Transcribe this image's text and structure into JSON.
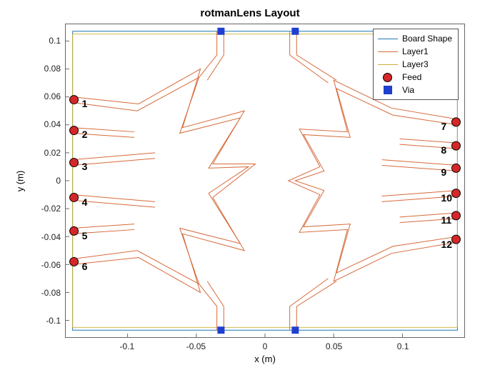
{
  "chart_data": {
    "type": "scatter",
    "title": "rotmanLens Layout",
    "xlabel": "x (m)",
    "ylabel": "y (m)",
    "xlim": [
      -0.145,
      0.145
    ],
    "ylim": [
      -0.112,
      0.112
    ],
    "x_ticks": [
      -0.1,
      -0.05,
      0,
      0.05,
      0.1
    ],
    "y_ticks": [
      -0.1,
      -0.08,
      -0.06,
      -0.04,
      -0.02,
      0,
      0.02,
      0.04,
      0.06,
      0.08,
      0.1
    ],
    "legend": {
      "entries": [
        "Board Shape",
        "Layer1",
        "Layer3",
        "Feed",
        "Via"
      ],
      "colors": {
        "Board Shape": "#1f77b4",
        "Layer1": "#d66a3a",
        "Layer3": "#c9b037",
        "Feed": "#d62728",
        "Via": "#1f3fd1"
      }
    },
    "series": [
      {
        "name": "Feed",
        "type": "marker",
        "shape": "circle",
        "points": [
          {
            "x": -0.139,
            "y": 0.058,
            "label": "1"
          },
          {
            "x": -0.139,
            "y": 0.036,
            "label": "2"
          },
          {
            "x": -0.139,
            "y": 0.013,
            "label": "3"
          },
          {
            "x": -0.139,
            "y": -0.012,
            "label": "4"
          },
          {
            "x": -0.139,
            "y": -0.036,
            "label": "5"
          },
          {
            "x": -0.139,
            "y": -0.058,
            "label": "6"
          },
          {
            "x": 0.139,
            "y": 0.042,
            "label": "7"
          },
          {
            "x": 0.139,
            "y": 0.025,
            "label": "8"
          },
          {
            "x": 0.139,
            "y": 0.009,
            "label": "9"
          },
          {
            "x": 0.139,
            "y": -0.009,
            "label": "10"
          },
          {
            "x": 0.139,
            "y": -0.025,
            "label": "11"
          },
          {
            "x": 0.139,
            "y": -0.042,
            "label": "12"
          }
        ]
      },
      {
        "name": "Via",
        "type": "marker",
        "shape": "square",
        "points": [
          {
            "x": -0.032,
            "y": 0.107
          },
          {
            "x": 0.022,
            "y": 0.107
          },
          {
            "x": -0.032,
            "y": -0.107
          },
          {
            "x": 0.022,
            "y": -0.107
          }
        ]
      },
      {
        "name": "Board Shape",
        "type": "polyline",
        "points": [
          [
            -0.14,
            0.107
          ],
          [
            0.14,
            0.107
          ],
          [
            0.14,
            -0.107
          ],
          [
            -0.14,
            -0.107
          ],
          [
            -0.14,
            0.107
          ]
        ]
      },
      {
        "name": "Layer3",
        "type": "polyline",
        "points": [
          [
            -0.14,
            0.105
          ],
          [
            0.14,
            0.105
          ],
          [
            0.14,
            -0.105
          ],
          [
            -0.14,
            -0.105
          ],
          [
            -0.14,
            0.105
          ]
        ]
      },
      {
        "name": "Layer1",
        "type": "polyline_group",
        "note": "approximate Rotman lens outline and feed arms",
        "polylines": [
          [
            [
              -0.14,
              0.06
            ],
            [
              -0.092,
              0.055
            ],
            [
              -0.047,
              0.08
            ],
            [
              -0.06,
              0.038
            ],
            [
              -0.015,
              0.05
            ],
            [
              -0.038,
              0.012
            ],
            [
              -0.007,
              0.012
            ],
            [
              -0.038,
              -0.012
            ],
            [
              -0.015,
              -0.05
            ],
            [
              -0.06,
              -0.038
            ],
            [
              -0.047,
              -0.08
            ],
            [
              -0.092,
              -0.055
            ],
            [
              -0.14,
              -0.06
            ]
          ],
          [
            [
              -0.14,
              0.056
            ],
            [
              -0.093,
              0.05
            ],
            [
              -0.048,
              0.074
            ],
            [
              -0.062,
              0.034
            ],
            [
              -0.018,
              0.045
            ],
            [
              -0.041,
              0.009
            ],
            [
              -0.012,
              0.01
            ],
            [
              -0.041,
              -0.009
            ],
            [
              -0.018,
              -0.045
            ],
            [
              -0.062,
              -0.034
            ],
            [
              -0.048,
              -0.074
            ],
            [
              -0.093,
              -0.05
            ],
            [
              -0.14,
              -0.056
            ]
          ],
          [
            [
              -0.14,
              0.038
            ],
            [
              -0.095,
              0.035
            ]
          ],
          [
            [
              -0.14,
              0.034
            ],
            [
              -0.095,
              0.031
            ]
          ],
          [
            [
              -0.14,
              0.015
            ],
            [
              -0.08,
              0.02
            ]
          ],
          [
            [
              -0.14,
              0.011
            ],
            [
              -0.08,
              0.016
            ]
          ],
          [
            [
              -0.14,
              -0.01
            ],
            [
              -0.08,
              -0.015
            ]
          ],
          [
            [
              -0.14,
              -0.014
            ],
            [
              -0.08,
              -0.019
            ]
          ],
          [
            [
              -0.14,
              -0.034
            ],
            [
              -0.095,
              -0.031
            ]
          ],
          [
            [
              -0.14,
              -0.038
            ],
            [
              -0.095,
              -0.035
            ]
          ],
          [
            [
              0.14,
              0.044
            ],
            [
              0.092,
              0.052
            ],
            [
              0.05,
              0.072
            ],
            [
              0.06,
              0.035
            ],
            [
              0.025,
              0.037
            ],
            [
              0.04,
              0.01
            ],
            [
              0.017,
              0.0
            ],
            [
              0.04,
              -0.01
            ],
            [
              0.025,
              -0.037
            ],
            [
              0.06,
              -0.035
            ],
            [
              0.05,
              -0.072
            ],
            [
              0.092,
              -0.052
            ],
            [
              0.14,
              -0.044
            ]
          ],
          [
            [
              0.14,
              0.04
            ],
            [
              0.093,
              0.047
            ],
            [
              0.052,
              0.066
            ],
            [
              0.062,
              0.031
            ],
            [
              0.028,
              0.033
            ],
            [
              0.043,
              0.007
            ],
            [
              0.022,
              0.0
            ],
            [
              0.043,
              -0.007
            ],
            [
              0.028,
              -0.033
            ],
            [
              0.062,
              -0.031
            ],
            [
              0.052,
              -0.066
            ],
            [
              0.093,
              -0.047
            ],
            [
              0.14,
              -0.04
            ]
          ],
          [
            [
              0.14,
              0.027
            ],
            [
              0.098,
              0.03
            ]
          ],
          [
            [
              0.14,
              0.023
            ],
            [
              0.098,
              0.026
            ]
          ],
          [
            [
              0.14,
              0.011
            ],
            [
              0.085,
              0.015
            ]
          ],
          [
            [
              0.14,
              0.007
            ],
            [
              0.085,
              0.011
            ]
          ],
          [
            [
              0.14,
              -0.007
            ],
            [
              0.085,
              -0.011
            ]
          ],
          [
            [
              0.14,
              -0.011
            ],
            [
              0.085,
              -0.015
            ]
          ],
          [
            [
              0.14,
              -0.023
            ],
            [
              0.098,
              -0.026
            ]
          ],
          [
            [
              0.14,
              -0.027
            ],
            [
              0.098,
              -0.03
            ]
          ],
          [
            [
              -0.035,
              0.107
            ],
            [
              -0.035,
              0.09
            ],
            [
              -0.048,
              0.074
            ]
          ],
          [
            [
              -0.03,
              0.107
            ],
            [
              -0.03,
              0.09
            ],
            [
              -0.042,
              0.072
            ]
          ],
          [
            [
              0.018,
              0.107
            ],
            [
              0.018,
              0.09
            ],
            [
              0.046,
              0.07
            ]
          ],
          [
            [
              0.023,
              0.107
            ],
            [
              0.023,
              0.09
            ],
            [
              0.052,
              0.072
            ]
          ],
          [
            [
              -0.035,
              -0.107
            ],
            [
              -0.035,
              -0.09
            ],
            [
              -0.048,
              -0.074
            ]
          ],
          [
            [
              -0.03,
              -0.107
            ],
            [
              -0.03,
              -0.09
            ],
            [
              -0.042,
              -0.072
            ]
          ],
          [
            [
              0.018,
              -0.107
            ],
            [
              0.018,
              -0.09
            ],
            [
              0.046,
              -0.07
            ]
          ],
          [
            [
              0.023,
              -0.107
            ],
            [
              0.023,
              -0.09
            ],
            [
              0.052,
              -0.072
            ]
          ]
        ]
      }
    ]
  }
}
